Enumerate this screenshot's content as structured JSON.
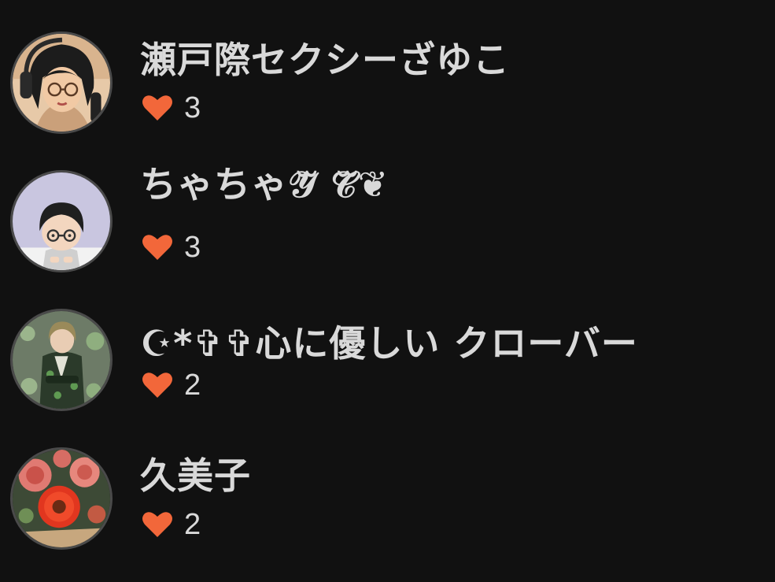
{
  "accent_heart_color": "#f2673a",
  "users": [
    {
      "name": "瀬戸際セクシーざゆこ",
      "likes": "3",
      "avatar": "woman-with-headphones-avatar"
    },
    {
      "name": "ちゃちゃ𝒴ᷓ 𝒞ᷓ❦",
      "likes": "3",
      "avatar": "boy-with-glasses-avatar"
    },
    {
      "name": "☪︎*✞✞心に優しい クローバー",
      "likes": "2",
      "avatar": "kimono-clover-avatar"
    },
    {
      "name": "久美子",
      "likes": "2",
      "avatar": "red-flowers-avatar"
    }
  ]
}
